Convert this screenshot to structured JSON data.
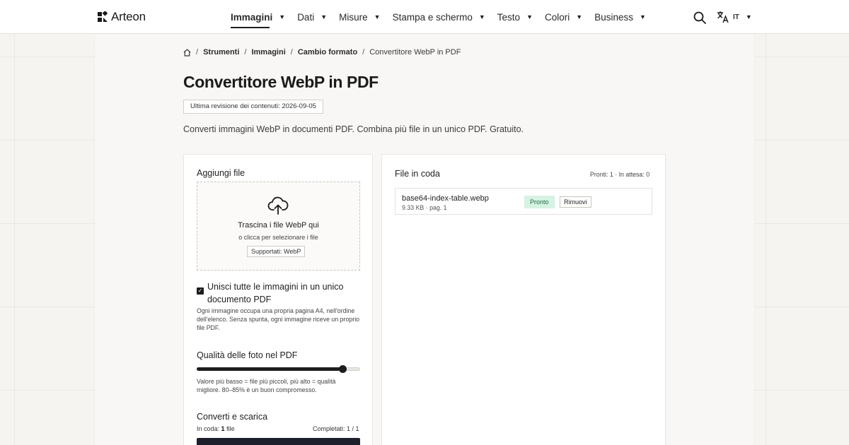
{
  "header": {
    "logo_text": "Arteon",
    "nav": [
      {
        "label": "Immagini",
        "active": true
      },
      {
        "label": "Dati"
      },
      {
        "label": "Misure"
      },
      {
        "label": "Stampa e schermo"
      },
      {
        "label": "Testo"
      },
      {
        "label": "Colori"
      },
      {
        "label": "Business"
      }
    ],
    "lang_code": "IT",
    "icons": {
      "search": "search-icon",
      "language": "translate-icon",
      "home": "home-icon"
    }
  },
  "breadcrumb": {
    "items": [
      "Strumenti",
      "Immagini",
      "Cambio formato"
    ],
    "current": "Convertitore WebP in PDF"
  },
  "page": {
    "title": "Convertitore WebP in PDF",
    "revision": "Ultima revisione dei contenuti: 2026-09-05",
    "description": "Converti immagini WebP in documenti PDF. Combina più file in un unico PDF. Gratuito."
  },
  "upload": {
    "title": "Aggiungi file",
    "drop_main": "Trascina i file WebP qui",
    "drop_sub": "o clicca per selezionare i file",
    "supported": "Supportati: WebP"
  },
  "merge": {
    "checked": true,
    "label": "Unisci tutte le immagini in un unico documento PDF",
    "help": "Ogni immagine occupa una propria pagina A4, nell'ordine dell'elenco. Senza spunta, ogni immagine riceve un proprio file PDF."
  },
  "quality": {
    "title": "Qualità delle foto nel PDF",
    "value_fraction": 0.89,
    "help": "Valore più basso = file più piccoli, più alto = qualità migliore. 80–85% è un buon compromesso."
  },
  "convert": {
    "title": "Converti e scarica",
    "queue_label": "In coda:",
    "queue_value": "1",
    "queue_unit": "file",
    "completed": "Completati: 1 / 1"
  },
  "queue": {
    "title": "File in coda",
    "status": "Pronti: 1 · In attesa: 0",
    "files": [
      {
        "name": "base64-index-table.webp",
        "meta": "9.33 KB · pag. 1",
        "status": "Pronto",
        "remove": "Rimuovi"
      }
    ]
  },
  "colors": {
    "accent": "#1d1d1d",
    "ready_bg": "#d6f2e3",
    "ready_text": "#1f6b43"
  }
}
